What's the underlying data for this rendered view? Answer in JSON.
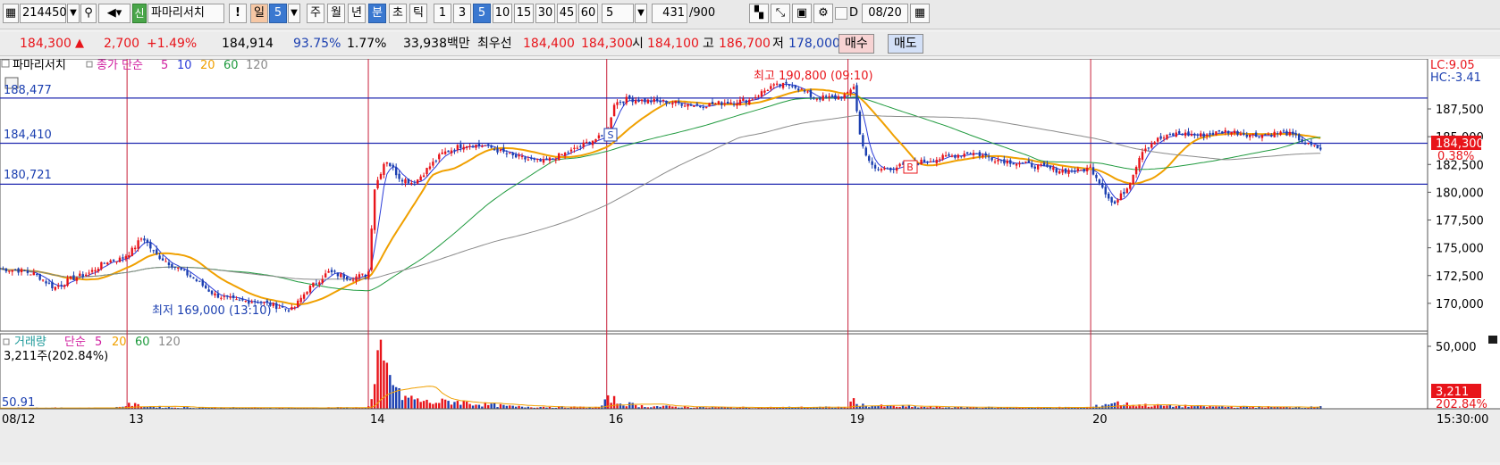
{
  "toolbar": {
    "code": "214450",
    "badge": "신",
    "name": "파마리서치",
    "excl": "!",
    "period_day": "일",
    "period_day_num": "5",
    "tabs": [
      "주",
      "월",
      "년",
      "분",
      "초",
      "틱"
    ],
    "minutes": [
      "1",
      "3",
      "5",
      "10",
      "15",
      "30",
      "45",
      "60"
    ],
    "selected_minute": "5",
    "count_value": "5",
    "bars_shown": "431",
    "bars_total": "/900",
    "d_label": "D",
    "date_value": "08/20"
  },
  "quote": {
    "price": "184,300",
    "arrow": "▲",
    "change": "2,700",
    "change_pct": "+1.49%",
    "prev_vol": "184,914",
    "ratio1": "93.75%",
    "ratio2": "1.77%",
    "amount": "33,938백만",
    "best_label": "최우선",
    "best_ask": "184,400",
    "best_bid": "184,300",
    "open_label": "시",
    "open": "184,100",
    "high_label": "고",
    "high": "186,700",
    "low_label": "저",
    "low": "178,000",
    "buy": "매수",
    "sell": "매도"
  },
  "colors": {
    "up": "#e8141a",
    "down": "#1b3fb0",
    "ma5": "#2a3bd8",
    "ma20": "#f0a000",
    "ma60": "#1f9a3e",
    "ma120": "#8a8a8a",
    "hline": "#2028b0",
    "vline": "#c8203a"
  },
  "chart_data": {
    "type": "candlestick",
    "title": "파마리서치",
    "legend": {
      "price_title": "파마리서치",
      "ma_label": "종가 단순",
      "periods": [
        "5",
        "10",
        "20",
        "60",
        "120"
      ],
      "volume_title": "거래량",
      "volume_ma_label": "단순",
      "volume_periods": [
        "5",
        "20",
        "60",
        "120"
      ]
    },
    "price_axis": {
      "ylim": [
        167500,
        192000
      ],
      "ticks": [
        "187,500",
        "185,000",
        "182,500",
        "180,000",
        "177,500",
        "175,000",
        "172,500",
        "170,000"
      ],
      "tick_values": [
        187500,
        185000,
        182500,
        180000,
        177500,
        175000,
        172500,
        170000
      ]
    },
    "volume_axis": {
      "ylim": [
        0,
        60000
      ],
      "ticks": [
        "50,000"
      ],
      "tick_values": [
        50000
      ]
    },
    "x_axis": {
      "labels": [
        "08/12",
        "13",
        "14",
        "16",
        "19",
        "20",
        "15:30:00"
      ],
      "day_lines": [
        0.089,
        0.258,
        0.425,
        0.594,
        0.764
      ]
    },
    "hlines": [
      {
        "label": "188,477",
        "value": 188477
      },
      {
        "label": "184,410",
        "value": 184410
      },
      {
        "label": "180,721",
        "value": 180721
      }
    ],
    "right_labels": {
      "lc": "LC:9.05",
      "hc": "HC:-3.41",
      "last_price": "184,300",
      "last_pct": "0.38%",
      "last_vol": "3,211",
      "last_vol_pct": "202.84%"
    },
    "annotations": {
      "max": "최고 190,800 (09:10)",
      "min": "최저 169,000 (13:10)",
      "s_mark": "S",
      "b_mark": "B",
      "vol_info": "3,211주(202.84%)",
      "vol_left": "50.91"
    },
    "close_anchors": [
      [
        0,
        173100
      ],
      [
        0.012,
        173000
      ],
      [
        0.025,
        172600
      ],
      [
        0.038,
        171400
      ],
      [
        0.05,
        172200
      ],
      [
        0.062,
        172700
      ],
      [
        0.075,
        173800
      ],
      [
        0.085,
        174000
      ],
      [
        0.092,
        174700
      ],
      [
        0.1,
        176000
      ],
      [
        0.108,
        174500
      ],
      [
        0.12,
        173500
      ],
      [
        0.135,
        172300
      ],
      [
        0.15,
        170800
      ],
      [
        0.165,
        170200
      ],
      [
        0.18,
        170200
      ],
      [
        0.195,
        169700
      ],
      [
        0.205,
        169400
      ],
      [
        0.215,
        171200
      ],
      [
        0.23,
        172800
      ],
      [
        0.245,
        172300
      ],
      [
        0.258,
        172600
      ],
      [
        0.262,
        180200
      ],
      [
        0.27,
        183000
      ],
      [
        0.28,
        181300
      ],
      [
        0.29,
        180800
      ],
      [
        0.3,
        182200
      ],
      [
        0.31,
        183500
      ],
      [
        0.325,
        184300
      ],
      [
        0.34,
        184200
      ],
      [
        0.36,
        183200
      ],
      [
        0.38,
        182700
      ],
      [
        0.4,
        183700
      ],
      [
        0.415,
        184700
      ],
      [
        0.425,
        185100
      ],
      [
        0.43,
        188000
      ],
      [
        0.44,
        188400
      ],
      [
        0.455,
        188200
      ],
      [
        0.47,
        188100
      ],
      [
        0.49,
        187800
      ],
      [
        0.51,
        188100
      ],
      [
        0.525,
        188300
      ],
      [
        0.54,
        189500
      ],
      [
        0.555,
        189700
      ],
      [
        0.57,
        188500
      ],
      [
        0.585,
        188500
      ],
      [
        0.594,
        188800
      ],
      [
        0.598,
        189600
      ],
      [
        0.603,
        184500
      ],
      [
        0.612,
        182000
      ],
      [
        0.625,
        182200
      ],
      [
        0.64,
        182600
      ],
      [
        0.66,
        183100
      ],
      [
        0.68,
        183600
      ],
      [
        0.7,
        182900
      ],
      [
        0.72,
        182500
      ],
      [
        0.74,
        182000
      ],
      [
        0.755,
        181900
      ],
      [
        0.764,
        182200
      ],
      [
        0.77,
        181000
      ],
      [
        0.78,
        178800
      ],
      [
        0.79,
        180500
      ],
      [
        0.8,
        183800
      ],
      [
        0.81,
        184700
      ],
      [
        0.825,
        185300
      ],
      [
        0.84,
        185100
      ],
      [
        0.86,
        185500
      ],
      [
        0.88,
        185100
      ],
      [
        0.9,
        185400
      ],
      [
        0.91,
        184800
      ],
      [
        0.915,
        184300
      ],
      [
        0.925,
        183900
      ]
    ],
    "volume_anchors": [
      [
        0,
        800
      ],
      [
        0.08,
        900
      ],
      [
        0.092,
        4200
      ],
      [
        0.1,
        2500
      ],
      [
        0.12,
        1200
      ],
      [
        0.2,
        900
      ],
      [
        0.25,
        1100
      ],
      [
        0.258,
        1500
      ],
      [
        0.262,
        14000
      ],
      [
        0.266,
        49000
      ],
      [
        0.27,
        35000
      ],
      [
        0.275,
        28000
      ],
      [
        0.28,
        12000
      ],
      [
        0.3,
        6000
      ],
      [
        0.32,
        7000
      ],
      [
        0.33,
        5000
      ],
      [
        0.36,
        2000
      ],
      [
        0.42,
        1300
      ],
      [
        0.428,
        11000
      ],
      [
        0.432,
        6000
      ],
      [
        0.45,
        2500
      ],
      [
        0.5,
        1200
      ],
      [
        0.594,
        1500
      ],
      [
        0.598,
        8000
      ],
      [
        0.605,
        3000
      ],
      [
        0.65,
        1500
      ],
      [
        0.72,
        1200
      ],
      [
        0.764,
        1300
      ],
      [
        0.78,
        6000
      ],
      [
        0.79,
        4000
      ],
      [
        0.81,
        3000
      ],
      [
        0.86,
        1800
      ],
      [
        0.92,
        1500
      ],
      [
        0.925,
        3211
      ]
    ]
  }
}
